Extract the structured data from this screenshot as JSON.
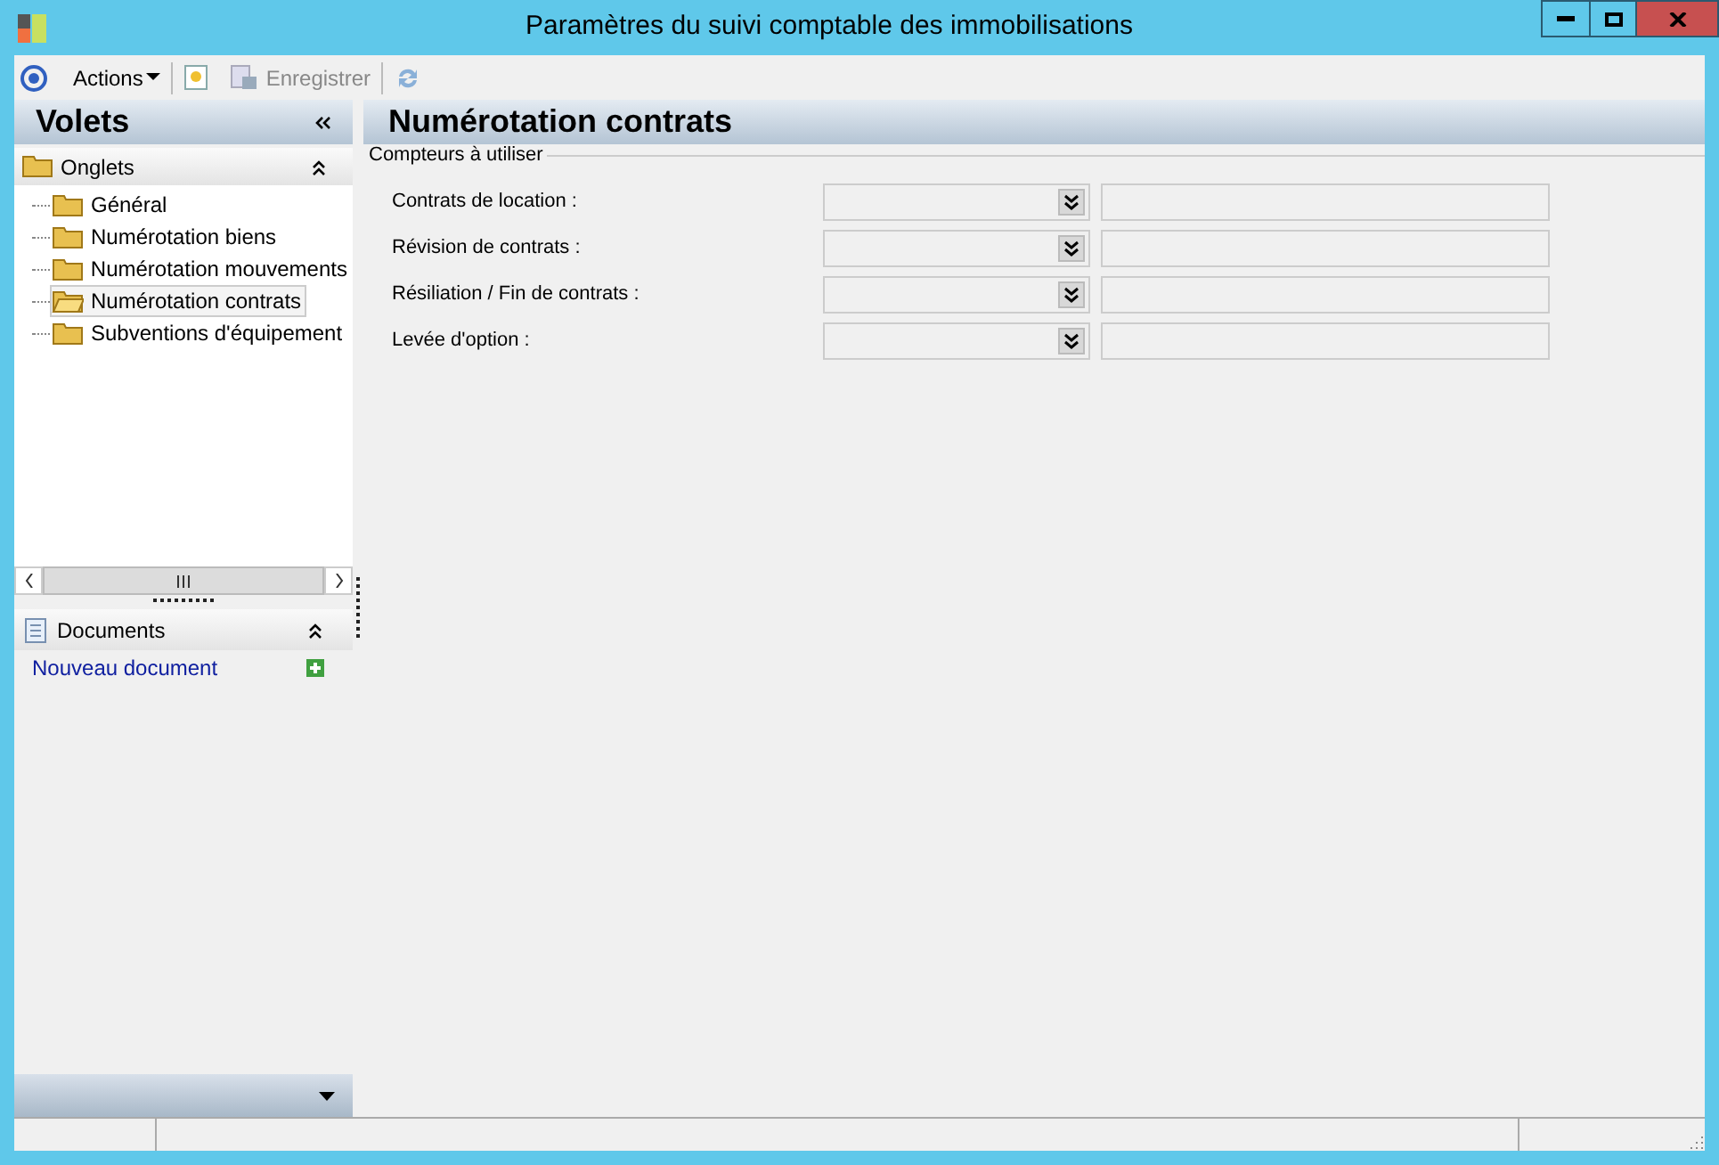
{
  "window": {
    "title": "Paramètres du suivi comptable des immobilisations"
  },
  "toolbar": {
    "actions": "Actions",
    "save": "Enregistrer"
  },
  "sidebar": {
    "title": "Volets",
    "sections": [
      {
        "title": "Onglets",
        "expanded": true,
        "items": [
          {
            "label": "Général",
            "selected": false
          },
          {
            "label": "Numérotation biens",
            "selected": false
          },
          {
            "label": "Numérotation mouvements",
            "selected": false
          },
          {
            "label": "Numérotation contrats",
            "selected": true
          },
          {
            "label": "Subventions d'équipement",
            "selected": false
          }
        ]
      },
      {
        "title": "Documents",
        "expanded": true,
        "link": "Nouveau document"
      }
    ]
  },
  "content": {
    "title": "Numérotation contrats",
    "group": "Compteurs à utiliser",
    "rows": [
      {
        "label": "Contrats de location :"
      },
      {
        "label": "Révision de contrats :"
      },
      {
        "label": "Résiliation / Fin de contrats :"
      },
      {
        "label": "Levée d'option :"
      }
    ]
  }
}
